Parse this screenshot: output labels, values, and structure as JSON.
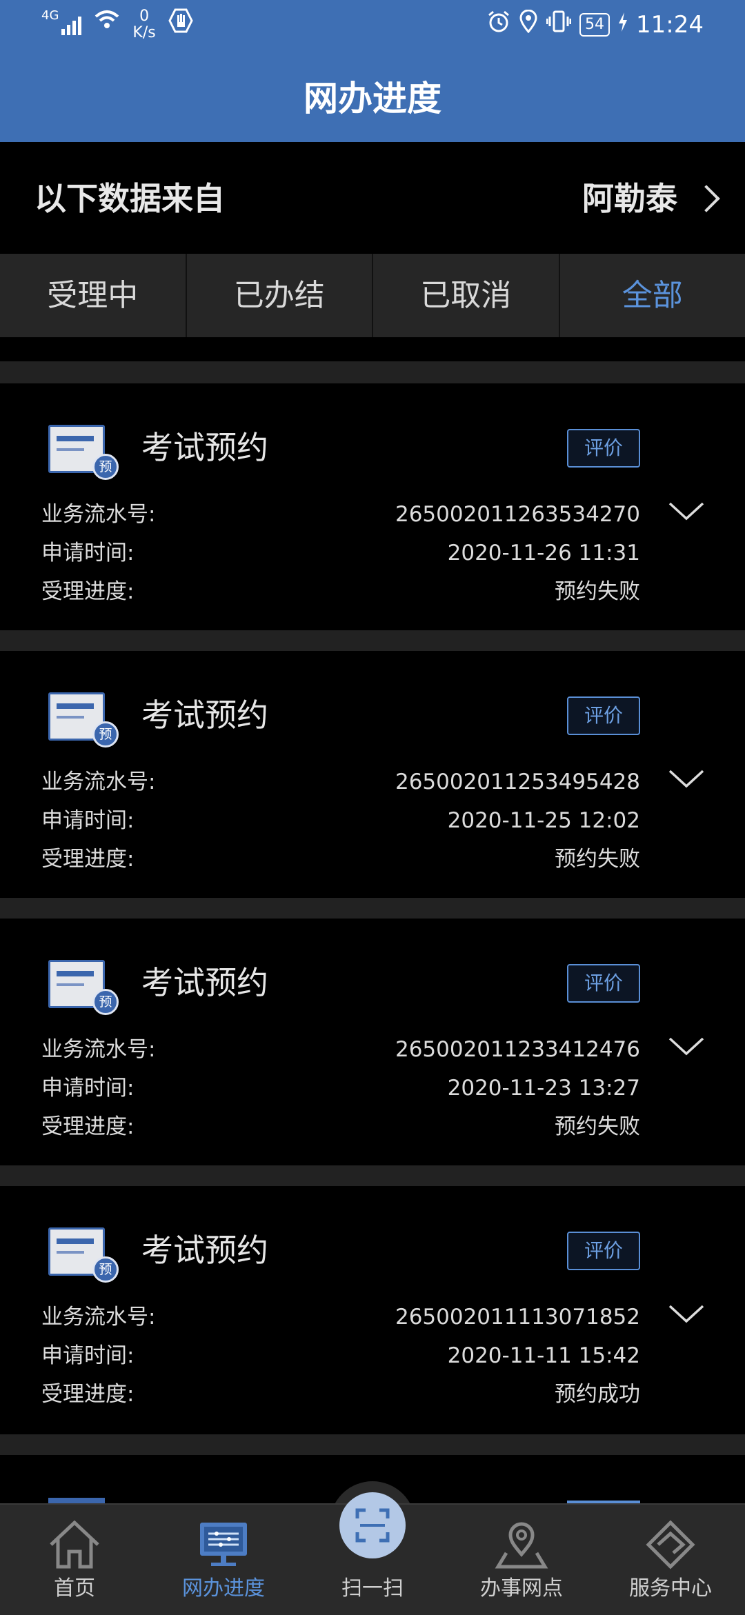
{
  "status": {
    "network": "4G",
    "speed_value": "0",
    "speed_unit": "K/s",
    "battery": "54",
    "time": "11:24"
  },
  "header": {
    "title": "网办进度"
  },
  "source": {
    "label": "以下数据来自",
    "city": "阿勒泰"
  },
  "tabs": [
    {
      "label": "受理中"
    },
    {
      "label": "已办结"
    },
    {
      "label": "已取消"
    },
    {
      "label": "全部"
    }
  ],
  "field_labels": {
    "serial": "业务流水号:",
    "apply_time": "申请时间:",
    "progress": "受理进度:"
  },
  "records": [
    {
      "title": "考试预约",
      "badge": "预",
      "rate_label": "评价",
      "serial": "265002011263534270",
      "apply_time": "2020-11-26 11:31",
      "progress": "预约失败"
    },
    {
      "title": "考试预约",
      "badge": "预",
      "rate_label": "评价",
      "serial": "265002011253495428",
      "apply_time": "2020-11-25 12:02",
      "progress": "预约失败"
    },
    {
      "title": "考试预约",
      "badge": "预",
      "rate_label": "评价",
      "serial": "265002011233412476",
      "apply_time": "2020-11-23 13:27",
      "progress": "预约失败"
    },
    {
      "title": "考试预约",
      "badge": "预",
      "rate_label": "评价",
      "serial": "265002011113071852",
      "apply_time": "2020-11-11 15:42",
      "progress": "预约成功"
    }
  ],
  "nav": [
    {
      "label": "首页",
      "icon": "home-icon"
    },
    {
      "label": "网办进度",
      "icon": "monitor-icon"
    },
    {
      "label": "扫一扫",
      "icon": "scan-icon"
    },
    {
      "label": "办事网点",
      "icon": "location-icon"
    },
    {
      "label": "服务中心",
      "icon": "handshake-icon"
    }
  ],
  "colors": {
    "header": "#3e6fb4",
    "accent": "#5b93dc",
    "background": "#000000"
  }
}
